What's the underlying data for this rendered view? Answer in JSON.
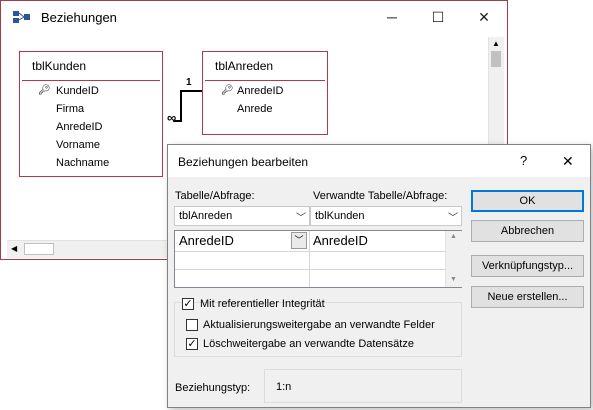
{
  "relationships_window": {
    "title": "Beziehungen",
    "icon": "relationships-icon",
    "controls": {
      "minimize": "─",
      "maximize": "☐",
      "close": "✕"
    },
    "tables": [
      {
        "name": "tblKunden",
        "fields": [
          "KundeID",
          "Firma",
          "AnredeID",
          "Vorname",
          "Nachname"
        ],
        "key_field": "KundeID"
      },
      {
        "name": "tblAnreden",
        "fields": [
          "AnredeID",
          "Anrede"
        ],
        "key_field": "AnredeID"
      }
    ],
    "relation": {
      "one": "1",
      "many": "∞"
    }
  },
  "dialog": {
    "title": "Beziehungen bearbeiten",
    "help": "?",
    "close": "✕",
    "table_label": "Tabelle/Abfrage:",
    "related_table_label": "Verwandte Tabelle/Abfrage:",
    "table_value": "tblAnreden",
    "related_table_value": "tblKunden",
    "field_rows": [
      {
        "left": "AnredeID",
        "right": "AnredeID"
      },
      {
        "left": "",
        "right": ""
      },
      {
        "left": "",
        "right": ""
      }
    ],
    "buttons": {
      "ok": "OK",
      "cancel": "Abbrechen",
      "join_type": "Verknüpfungstyp...",
      "create_new": "Neue erstellen..."
    },
    "checkboxes": [
      {
        "label": "Mit referentieller Integrität",
        "checked": true
      },
      {
        "label": "Aktualisierungsweitergabe an verwandte Felder",
        "checked": false
      },
      {
        "label": "Löschweitergabe an verwandte Datensätze",
        "checked": true
      }
    ],
    "relationship_type_label": "Beziehungstyp:",
    "relationship_type_value": "1:n"
  }
}
